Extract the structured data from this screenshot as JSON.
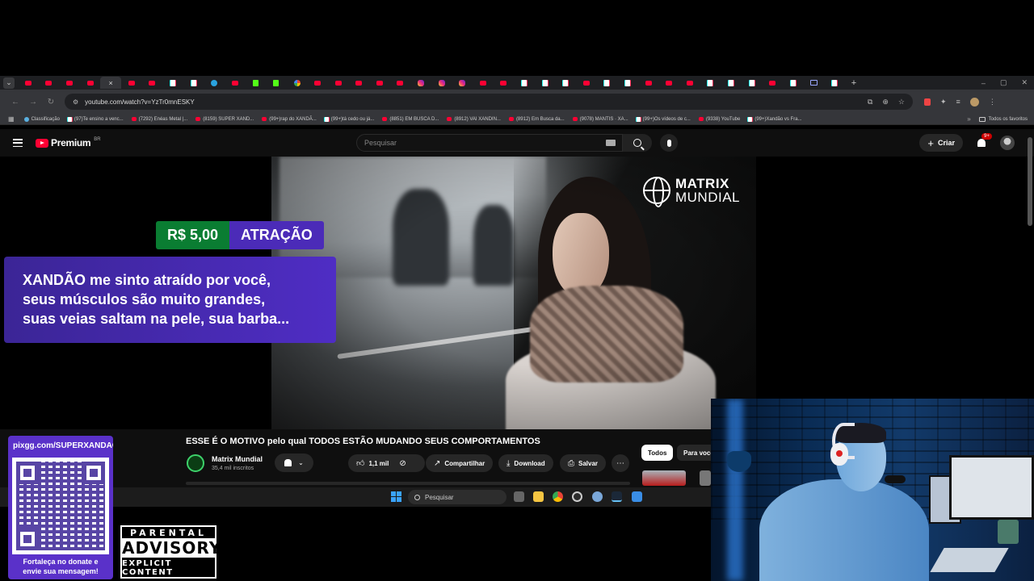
{
  "browser": {
    "tabs": [
      "yt",
      "yt",
      "yt",
      "yt",
      "yt",
      "yt",
      "tk",
      "tk",
      "tg",
      "yt",
      "kick",
      "kick",
      "goo",
      "yt",
      "yt",
      "yt",
      "yt",
      "yt",
      "ig",
      "ig",
      "ig",
      "yt",
      "yt",
      "tk",
      "tk",
      "tk",
      "yt",
      "tk",
      "tk",
      "yt",
      "yt",
      "yt",
      "tk",
      "tk",
      "tk",
      "yt",
      "tk",
      "scr",
      "tk"
    ],
    "active_tab_close": "×",
    "new_tab": "+",
    "window_controls": [
      "–",
      "▢",
      "✕"
    ],
    "url": "youtube.com/watch?v=YzTr0mnESKY",
    "bookmarks": [
      {
        "icon": "gem",
        "label": "Classificação"
      },
      {
        "icon": "tk",
        "label": "(97)Te ensino a venc..."
      },
      {
        "icon": "yt",
        "label": "(7292) Enéas Metal |..."
      },
      {
        "icon": "yt",
        "label": "(8159) SUPER XAND..."
      },
      {
        "icon": "yt",
        "label": "(99+)rap do XANDÃ..."
      },
      {
        "icon": "tk",
        "label": "(99+)tá cedo ou já..."
      },
      {
        "icon": "yt",
        "label": "(8851) EM BUSCA D..."
      },
      {
        "icon": "yt",
        "label": "(8912) VAI XANDIN..."
      },
      {
        "icon": "yt",
        "label": "(8912) Em Busca da..."
      },
      {
        "icon": "yt",
        "label": "(9078) MANTIS · XA..."
      },
      {
        "icon": "tk",
        "label": "(99+)Os vídeos de c..."
      },
      {
        "icon": "yt",
        "label": "(9338) YouTube"
      },
      {
        "icon": "tk",
        "label": "(99+)Xandão vs Fra..."
      }
    ],
    "bookmarks_more": "»",
    "all_bookmarks": "Todos os favoritos"
  },
  "youtube": {
    "logo_text": "Premium",
    "country": "BR",
    "search_placeholder": "Pesquisar",
    "create_label": "Criar",
    "notifications": "9+",
    "video": {
      "logo_line1": "MATRIX",
      "logo_line2": "MUNDIAL"
    },
    "title": "ESSE É O MOTIVO pelo qual TODOS ESTÃO MUDANDO SEUS COMPORTAMENTOS",
    "channel": "Matrix Mundial",
    "subscribers": "35,4 mil inscritos",
    "likes": "1,1 mil",
    "share": "Compartilhar",
    "download": "Download",
    "save": "Salvar",
    "chips": [
      "Todos",
      "Para você"
    ]
  },
  "donation": {
    "amount": "R$ 5,00",
    "tier": "ATRAÇÃO",
    "message_lines": [
      "XANDÃO me sinto atraído por você,",
      "seus músculos são muito grandes,",
      "suas veias saltam na pele, sua barba..."
    ]
  },
  "taskbar": {
    "search_placeholder": "Pesquisar"
  },
  "stream_overlay": {
    "qr_url": "pixgg.com/SUPERXANDAO",
    "qr_caption_line1": "Fortaleça no donate e",
    "qr_caption_line2": "envie sua mensagem!",
    "advisory_top": "PARENTAL",
    "advisory_mid": "ADVISORY",
    "advisory_bottom": "EXPLICIT CONTENT"
  }
}
